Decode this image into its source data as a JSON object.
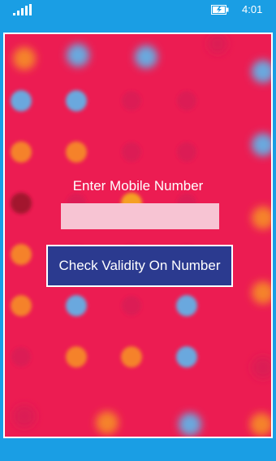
{
  "status_bar": {
    "time": "4:01",
    "signal_icon": "signal-bars-icon",
    "battery_icon": "battery-charging-icon"
  },
  "app": {
    "prompt_label": "Enter Mobile Number",
    "mobile_input": {
      "value": "",
      "placeholder": ""
    },
    "check_button_label": "Check Validity On Number"
  },
  "colors": {
    "system_accent": "#1a9ee4",
    "panel_background": "#ec1c52",
    "button_background": "#2b3a8f",
    "input_background": "#f7c4d3",
    "dot_orange": "#f5822a",
    "dot_blue": "#6ba8de",
    "dot_dark_red": "#a3182f",
    "dot_pink": "#dc1a55"
  }
}
